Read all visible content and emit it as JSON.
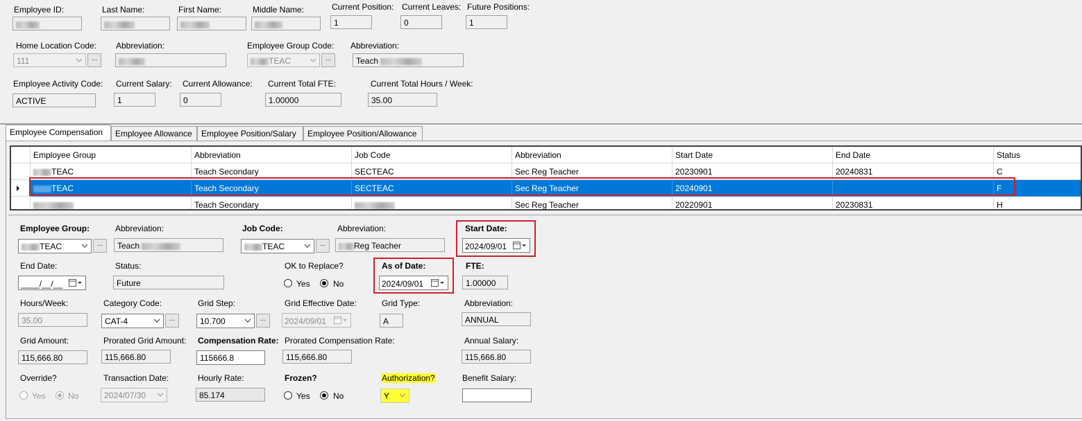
{
  "header": {
    "employee_id_label": "Employee ID:",
    "last_name_label": "Last Name:",
    "first_name_label": "First Name:",
    "middle_name_label": "Middle Name:",
    "current_position_label": "Current Position:",
    "current_position_value": "1",
    "current_leaves_label": "Current Leaves:",
    "current_leaves_value": "0",
    "future_positions_label": "Future Positions:",
    "future_positions_value": "1",
    "home_location_label": "Home Location Code:",
    "home_location_value": "111",
    "abbreviation_label": "Abbreviation:",
    "employee_group_code_label": "Employee Group Code:",
    "employee_group_code_value": "TEAC",
    "group_abbreviation_label": "Abbreviation:",
    "group_abbreviation_value": "Teach",
    "activity_code_label": "Employee Activity Code:",
    "activity_code_value": "ACTIVE",
    "current_salary_label": "Current Salary:",
    "current_salary_value": "1",
    "current_allowance_label": "Current Allowance:",
    "current_allowance_value": "0",
    "current_total_fte_label": "Current Total FTE:",
    "current_total_fte_value": "1.00000",
    "current_hours_label": "Current Total Hours / Week:",
    "current_hours_value": "35.00"
  },
  "tabs": [
    {
      "label": "Employee Compensation"
    },
    {
      "label": "Employee Allowance"
    },
    {
      "label": "Employee Position/Salary"
    },
    {
      "label": "Employee Position/Allowance"
    }
  ],
  "grid": {
    "columns": [
      "Employee Group",
      "Abbreviation",
      "Job Code",
      "Abbreviation",
      "Start Date",
      "End Date",
      "Status"
    ],
    "rows": [
      {
        "group": "TEAC",
        "abbr": "Teach Secondary",
        "job": "SECTEAC",
        "job_abbr": "Sec Reg Teacher",
        "start": "20230901",
        "end": "20240831",
        "status": "C"
      },
      {
        "group": "TEAC",
        "abbr": "Teach Secondary",
        "job": "SECTEAC",
        "job_abbr": "Sec Reg Teacher",
        "start": "20240901",
        "end": "",
        "status": "F"
      },
      {
        "group": "",
        "abbr": "Teach Secondary",
        "job": "",
        "job_abbr": "Sec Reg Teacher",
        "start": "20220901",
        "end": "20230831",
        "status": "H"
      }
    ]
  },
  "detail": {
    "employee_group_label": "Employee Group:",
    "employee_group_value": "TEAC",
    "abbreviation_label": "Abbreviation:",
    "abbreviation_value": "Teach",
    "job_code_label": "Job Code:",
    "job_code_value": "TEAC",
    "job_abbreviation_label": "Abbreviation:",
    "job_abbreviation_value": "Reg Teacher",
    "start_date_label": "Start Date:",
    "start_date_value": "2024/09/01",
    "end_date_label": "End Date:",
    "end_date_value": "____/__/__",
    "status_label": "Status:",
    "status_value": "Future",
    "ok_replace_label": "OK to Replace?",
    "yes_label": "Yes",
    "no_label": "No",
    "as_of_date_label": "As of Date:",
    "as_of_date_value": "2024/09/01",
    "fte_label": "FTE:",
    "fte_value": "1.00000",
    "hours_week_label": "Hours/Week:",
    "hours_week_value": "35.00",
    "category_code_label": "Category Code:",
    "category_code_value": "CAT-4",
    "grid_step_label": "Grid Step:",
    "grid_step_value": "10.700",
    "grid_effective_date_label": "Grid Effective Date:",
    "grid_effective_date_value": "2024/09/01",
    "grid_type_label": "Grid Type:",
    "grid_type_value": "A",
    "grid_type_abbr_label": "Abbreviation:",
    "grid_type_abbr_value": "ANNUAL",
    "grid_amount_label": "Grid Amount:",
    "grid_amount_value": "115,666.80",
    "prorated_grid_label": "Prorated Grid Amount:",
    "prorated_grid_value": "115,666.80",
    "compensation_rate_label": "Compensation Rate:",
    "compensation_rate_value": "115666.8",
    "prorated_comp_label": "Prorated Compensation Rate:",
    "prorated_comp_value": "115,666.80",
    "annual_salary_label": "Annual Salary:",
    "annual_salary_value": "115,666.80",
    "override_label": "Override?",
    "transaction_date_label": "Transaction Date:",
    "transaction_date_value": "2024/07/30",
    "hourly_rate_label": "Hourly Rate:",
    "hourly_rate_value": "85.174",
    "frozen_label": "Frozen?",
    "authorization_label": "Authorization?",
    "authorization_value": "Y",
    "benefit_salary_label": "Benefit Salary:",
    "benefit_salary_value": ""
  },
  "icons": {
    "ellipsis": "...",
    "calendar": "calendar-icon",
    "dropdown": "chevron-down-icon",
    "row_pointer": "row-pointer-icon"
  },
  "colors": {
    "selection": "#0078d7",
    "highlight_box": "#d0202a",
    "authorization_highlight": "#ffff33"
  }
}
